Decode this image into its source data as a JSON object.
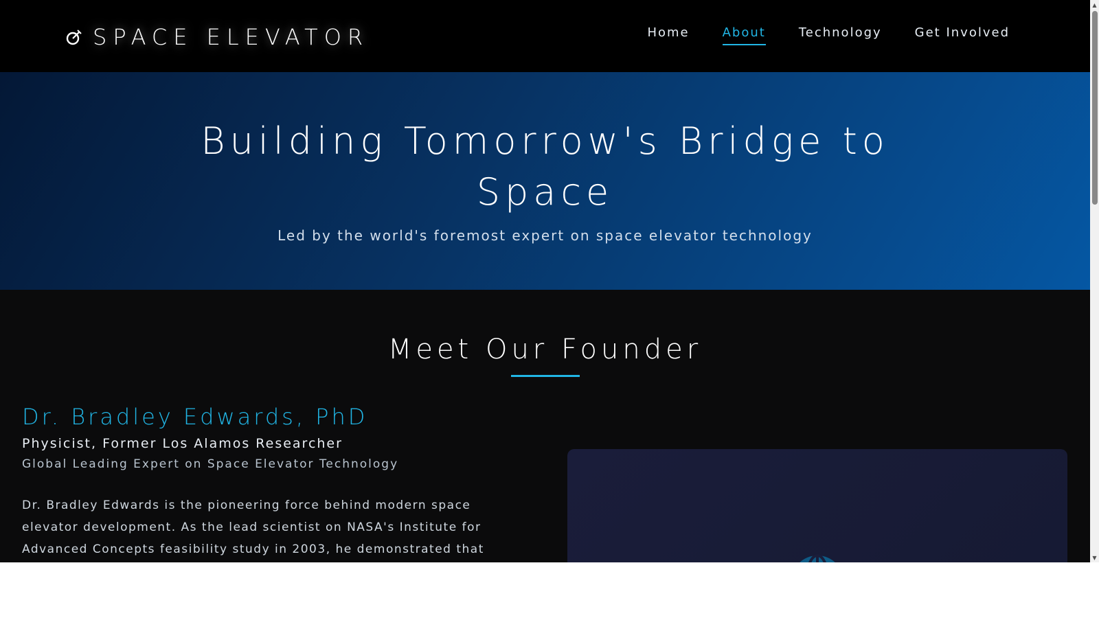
{
  "header": {
    "logo_text": "SPACE ELEVATOR",
    "nav": [
      {
        "label": "Home",
        "active": false
      },
      {
        "label": "About",
        "active": true
      },
      {
        "label": "Technology",
        "active": false
      },
      {
        "label": "Get Involved",
        "active": false
      }
    ]
  },
  "hero": {
    "title": "Building Tomorrow's Bridge to Space",
    "subtitle": "Led by the world's foremost expert on space elevator technology"
  },
  "founder": {
    "section_title": "Meet Our Founder",
    "name": "Dr. Bradley Edwards, PhD",
    "role": "Physicist, Former Los Alamos Researcher",
    "tagline": "Global Leading Expert on Space Elevator Technology",
    "bio": "Dr. Bradley Edwards is the pioneering force behind modern space elevator development. As the lead scientist on NASA's Institute for Advanced Concepts feasibility study in 2003, he demonstrated that space elevator"
  },
  "icons": {
    "logo": "satellite-dish-icon",
    "image_card": "globe-icon",
    "scroll_up": "arrow-up-icon",
    "scroll_down": "arrow-down-icon"
  },
  "colors": {
    "accent": "#21b6e6",
    "header_bg": "#000000",
    "page_bg": "#0b0b0c",
    "hero_start": "#041836",
    "hero_end": "#0557a3",
    "card_bg": "#1a1d3a"
  }
}
